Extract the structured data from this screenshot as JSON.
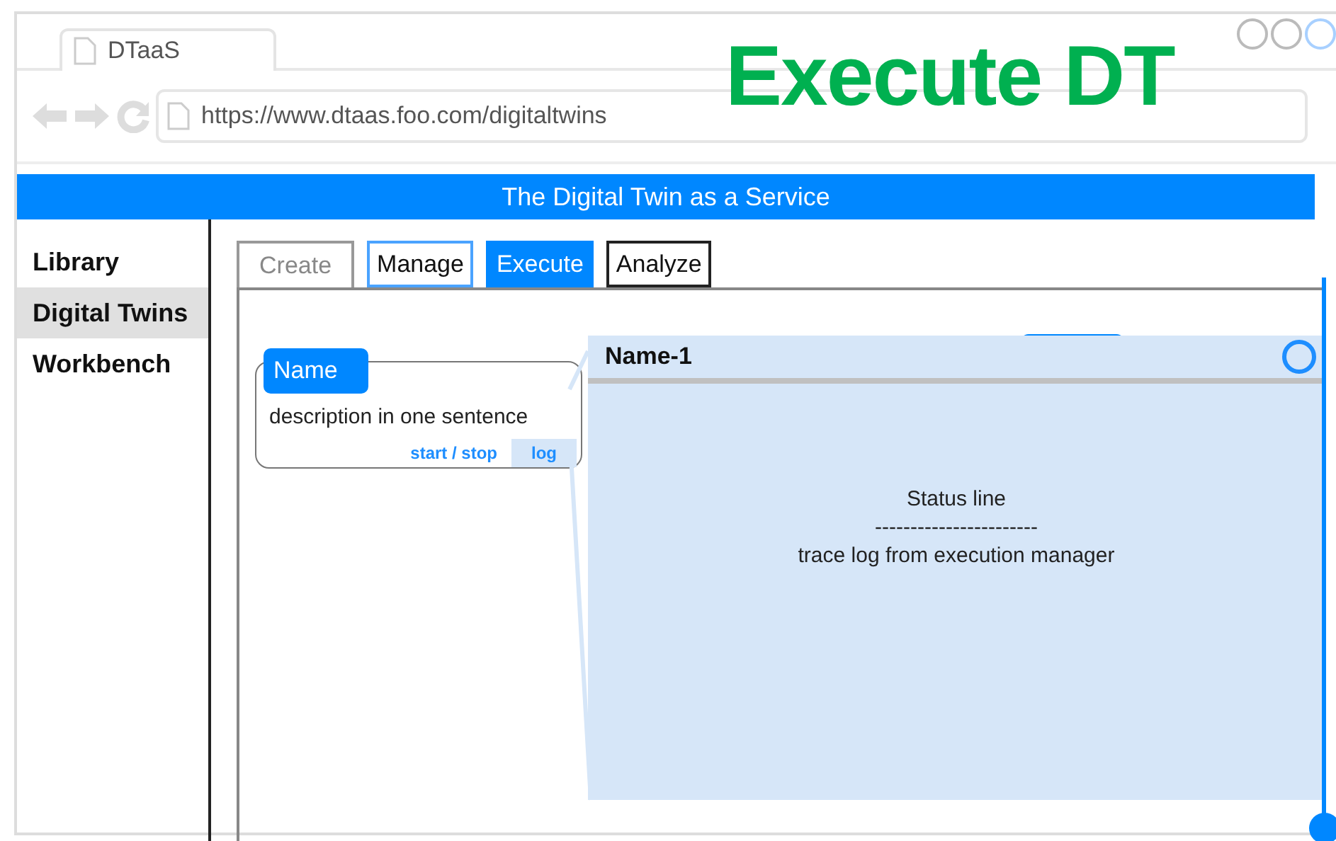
{
  "browser": {
    "tab_title": "DTaaS",
    "url": "https://www.dtaas.foo.com/digitaltwins"
  },
  "overlay_title": "Execute DT",
  "app": {
    "header": "The Digital Twin as a Service"
  },
  "sidebar": {
    "items": [
      {
        "label": "Library",
        "selected": false
      },
      {
        "label": "Digital Twins",
        "selected": true
      },
      {
        "label": "Workbench",
        "selected": false
      }
    ]
  },
  "tabs": [
    {
      "label": "Create",
      "selected": false,
      "disabled": true,
      "highlighted": false
    },
    {
      "label": "Manage",
      "selected": false,
      "disabled": false,
      "highlighted": true
    },
    {
      "label": "Execute",
      "selected": true,
      "disabled": false,
      "highlighted": false
    },
    {
      "label": "Analyze",
      "selected": false,
      "disabled": false,
      "highlighted": false
    }
  ],
  "card": {
    "name": "Name",
    "description": "description in one sentence",
    "actions": [
      {
        "label": "start / stop",
        "selected": false
      },
      {
        "label": "log",
        "selected": true
      }
    ]
  },
  "log_panel": {
    "title": "Name-1",
    "lines": [
      "Status line",
      "-----------------------",
      "trace log from execution manager"
    ]
  }
}
